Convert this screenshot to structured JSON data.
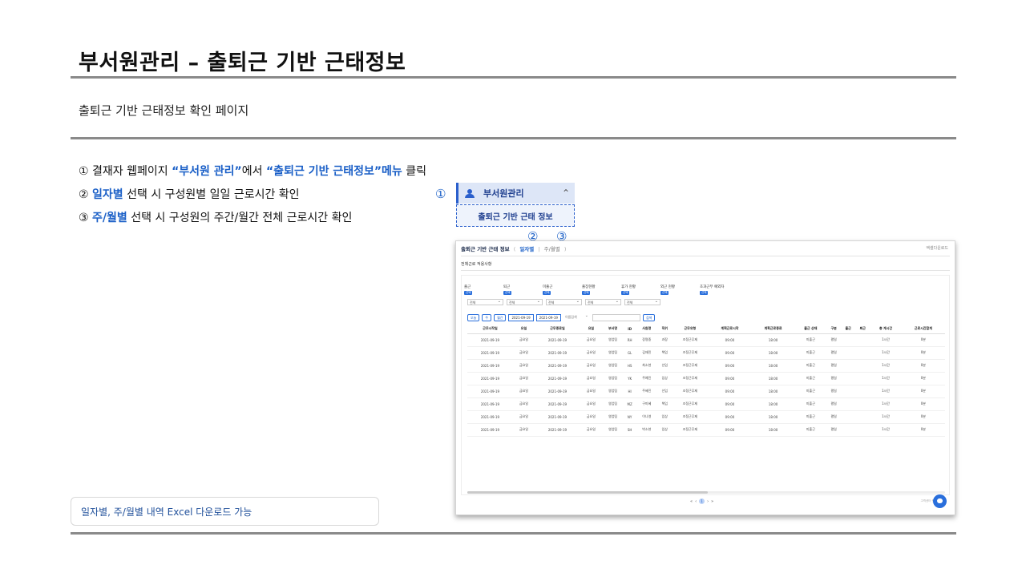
{
  "slide": {
    "title": "부서원관리 – 출퇴근 기반 근태정보",
    "subtitle": "출퇴근 기반 근태정보 확인 페이지"
  },
  "steps": [
    {
      "num": "①",
      "pre": " 결재자 웹페이지 ",
      "hl1": "“부서원 관리”",
      "mid": "에서 ",
      "hl2": "“출퇴근 기반 근태정보”메뉴",
      "post": " 클릭"
    },
    {
      "num": "②",
      "pre": " ",
      "hl1": "일자별",
      "post": " 선택 시 구성원별 일일 근로시간 확인"
    },
    {
      "num": "③",
      "pre": " ",
      "hl1": "주/월별",
      "post": " 선택 시 구성원의 주간/월간 전체 근로시간 확인"
    }
  ],
  "note": "일자별, 주/월별 내역 Excel 다운로드 가능",
  "markers": {
    "m1": "①",
    "m2": "②",
    "m3": "③"
  },
  "menu": {
    "header_label": "부서원관리",
    "sub_label": "출퇴근 기반 근태 정보"
  },
  "screen": {
    "title": "출퇴근 기반 근태 정보",
    "tab_open": "(",
    "tab_daily": "일자별",
    "tab_sep": "|",
    "tab_weekly": "주/월별",
    "tab_close": ")",
    "top_right": "엑셀다운로드",
    "sub_title": "전체근로 적용사항",
    "filters": [
      {
        "label": "출근",
        "badge": "선택"
      },
      {
        "label": "퇴근",
        "badge": "선택"
      },
      {
        "label": "미출근",
        "badge": "선택"
      },
      {
        "label": "출장현황",
        "badge": "선택"
      },
      {
        "label": "휴가 현황",
        "badge": "선택"
      },
      {
        "label": "외근 현황",
        "badge": "선택"
      },
      {
        "label": "초과근무 예외자",
        "badge": "선택"
      }
    ],
    "selects": [
      "전체",
      "전체",
      "전체",
      "전체",
      "전체"
    ],
    "ctrl": {
      "btn_today": "오늘",
      "btn_week": "주",
      "btn_month": "월간",
      "date_from": "2021-09-19",
      "date_to": "2021-09-19",
      "search_select": "이름검색",
      "search_btn": "검색"
    },
    "columns": [
      "근무시작일",
      "요일",
      "근무종료일",
      "요일",
      "부서명",
      "ID",
      "사원명",
      "직위",
      "근무유형",
      "계획근로시작",
      "계획근로종료",
      "출근 상태",
      "구분",
      "출근",
      "퇴근",
      "총 계시간",
      "근로시간합계"
    ],
    "rows": [
      [
        "2021-09-19",
        "금요일",
        "2021-09-19",
        "금요일",
        "영업팀",
        "RH",
        "장명중",
        "과장",
        "조정근무제",
        "09:00",
        "18:00",
        "미출근",
        "평일",
        "",
        "",
        "1시간",
        "0분"
      ],
      [
        "2021-09-19",
        "금요일",
        "2021-09-19",
        "금요일",
        "영업팀",
        "GL",
        "김재민",
        "책임",
        "조정근무제",
        "09:00",
        "18:00",
        "미출근",
        "평일",
        "",
        "",
        "1시간",
        "0분"
      ],
      [
        "2021-09-19",
        "금요일",
        "2021-09-19",
        "금요일",
        "영업팀",
        "HS",
        "최소현",
        "선임",
        "조정근무제",
        "09:00",
        "18:00",
        "미출근",
        "평일",
        "",
        "",
        "1시간",
        "0분"
      ],
      [
        "2021-09-19",
        "금요일",
        "2021-09-19",
        "금요일",
        "영업팀",
        "YK",
        "주예진",
        "임상",
        "조정근무제",
        "09:00",
        "18:00",
        "미출근",
        "평일",
        "",
        "",
        "1시간",
        "0분"
      ],
      [
        "2021-09-19",
        "금요일",
        "2021-09-19",
        "금요일",
        "영업팀",
        "HI",
        "주혜진",
        "선임",
        "조정근무제",
        "09:00",
        "18:00",
        "미출근",
        "평일",
        "",
        "",
        "1시간",
        "0분"
      ],
      [
        "2021-09-19",
        "금요일",
        "2021-09-19",
        "금요일",
        "영업팀",
        "MZ",
        "구미혜",
        "책임",
        "조정근무제",
        "09:00",
        "18:00",
        "미출근",
        "평일",
        "",
        "",
        "1시간",
        "0분"
      ],
      [
        "2021-09-19",
        "금요일",
        "2021-09-19",
        "금요일",
        "영업팀",
        "NY",
        "이나영",
        "임상",
        "조정근무제",
        "09:00",
        "18:00",
        "미출근",
        "평일",
        "",
        "",
        "1시간",
        "0분"
      ],
      [
        "2021-09-19",
        "금요일",
        "2021-09-19",
        "금요일",
        "영업팀",
        "SH",
        "박소현",
        "임상",
        "조정근무제",
        "09:00",
        "18:00",
        "미출근",
        "평일",
        "",
        "",
        "1시간",
        "0분"
      ]
    ],
    "pager": {
      "prev2": "«",
      "prev": "‹",
      "current": "1",
      "next": "›",
      "next2": "»"
    },
    "footer_right": "고객센터 문의"
  }
}
